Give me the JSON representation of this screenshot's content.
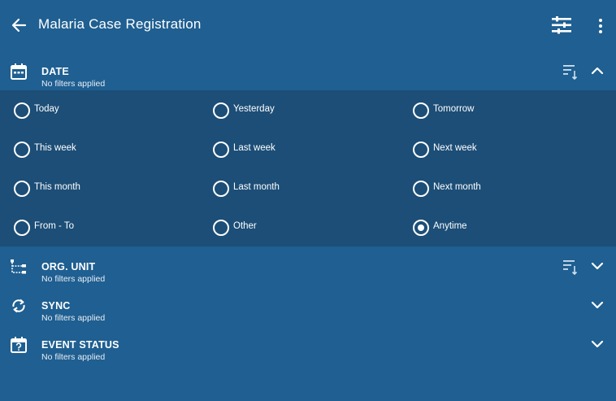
{
  "toolbar": {
    "title": "Malaria Case Registration"
  },
  "sections": {
    "date": {
      "name": "DATE",
      "sub": "No filters applied"
    },
    "org_unit": {
      "name": "ORG. UNIT",
      "sub": "No filters applied"
    },
    "sync": {
      "name": "SYNC",
      "sub": "No filters applied"
    },
    "event_status": {
      "name": "EVENT STATUS",
      "sub": "No filters applied"
    }
  },
  "date_options": {
    "today": "Today",
    "yesterday": "Yesterday",
    "tomorrow": "Tomorrow",
    "this_week": "This week",
    "last_week": "Last week",
    "next_week": "Next week",
    "this_month": "This month",
    "last_month": "Last month",
    "next_month": "Next month",
    "from_to": "From - To",
    "other": "Other",
    "anytime": "Anytime",
    "selected": "Anytime"
  },
  "icons": {
    "back": "arrow-back-icon",
    "filter": "filter-list-icon",
    "more": "more-vert-icon",
    "calendar": "calendar-icon",
    "org_tree": "org-tree-icon",
    "sync": "sync-icon",
    "event_status": "calendar-question-icon",
    "sort": "sort-icon",
    "chevron_up": "chevron-up-icon",
    "chevron_down": "chevron-down-icon"
  },
  "colors": {
    "header_bg": "#1f5f91",
    "options_bg": "#1c4e77",
    "text": "#ffffff"
  }
}
